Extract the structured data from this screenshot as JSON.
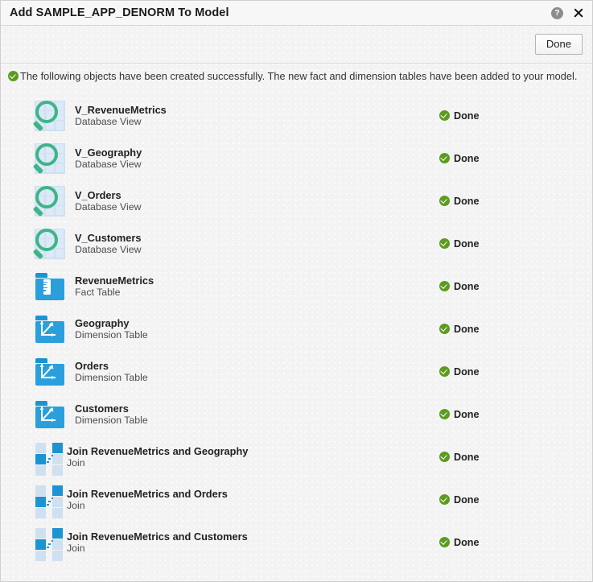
{
  "window": {
    "title": "Add SAMPLE_APP_DENORM To Model",
    "help_icon": "help-icon",
    "close_icon": "close-icon"
  },
  "toolbar": {
    "done_label": "Done"
  },
  "status_message": {
    "icon": "success-check-icon",
    "text": "The following objects have been created successfully. The new fact and dimension tables have been added to your model."
  },
  "colors": {
    "accent_blue": "#2a9fdc",
    "accent_blue_dark": "#1b94d4",
    "grid_blue_light": "#dce9f6",
    "magnifier_green": "#3eb489",
    "success_green": "#5b9b1e",
    "background": "#f3f3f3",
    "titlebar": "#f7f7f7"
  },
  "objects": [
    {
      "name": "V_RevenueMetrics",
      "type": "Database View",
      "icon": "database-view-icon",
      "status": "Done"
    },
    {
      "name": "V_Geography",
      "type": "Database View",
      "icon": "database-view-icon",
      "status": "Done"
    },
    {
      "name": "V_Orders",
      "type": "Database View",
      "icon": "database-view-icon",
      "status": "Done"
    },
    {
      "name": "V_Customers",
      "type": "Database View",
      "icon": "database-view-icon",
      "status": "Done"
    },
    {
      "name": "RevenueMetrics",
      "type": "Fact Table",
      "icon": "fact-table-icon",
      "status": "Done"
    },
    {
      "name": "Geography",
      "type": "Dimension Table",
      "icon": "dimension-table-icon",
      "status": "Done"
    },
    {
      "name": "Orders",
      "type": "Dimension Table",
      "icon": "dimension-table-icon",
      "status": "Done"
    },
    {
      "name": "Customers",
      "type": "Dimension Table",
      "icon": "dimension-table-icon",
      "status": "Done"
    },
    {
      "name": "Join RevenueMetrics and Geography",
      "type": "Join",
      "icon": "join-icon",
      "status": "Done"
    },
    {
      "name": "Join RevenueMetrics and Orders",
      "type": "Join",
      "icon": "join-icon",
      "status": "Done"
    },
    {
      "name": "Join RevenueMetrics and Customers",
      "type": "Join",
      "icon": "join-icon",
      "status": "Done"
    }
  ]
}
